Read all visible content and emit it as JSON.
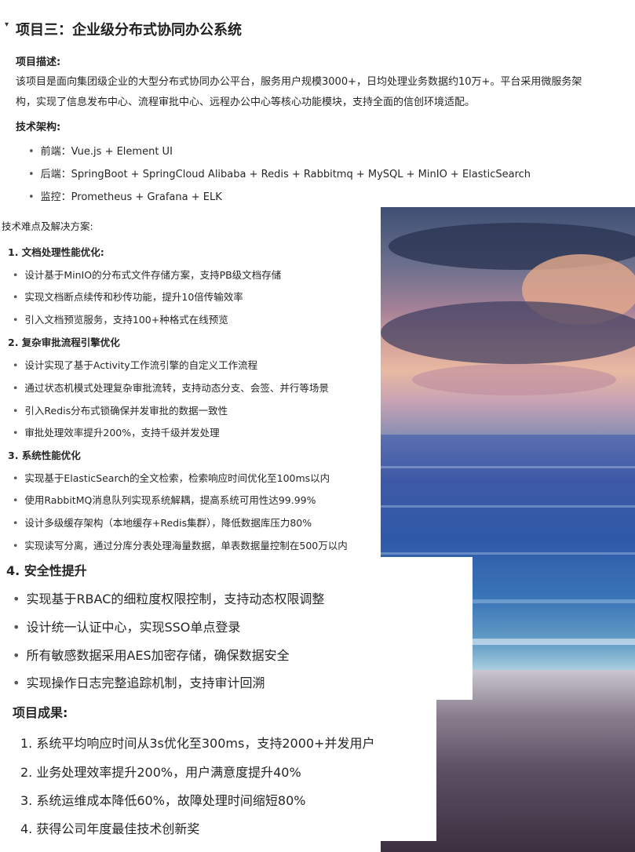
{
  "section1": {
    "title": "项目三：企业级分布式协同办公系统",
    "desc_label": "项目描述:",
    "desc_line1": "该项目是面向集团级企业的大型分布式协同办公平台，服务用户规模3000+，日均处理业务数据约10万+。平台采用微服务架",
    "desc_line2": "构，实现了信息发布中心、流程审批中心、远程办公中心等核心功能模块，支持全面的信创环境适配。",
    "arch_label": "技术架构:",
    "arch_items": [
      "前端：Vue.js + Element UI",
      "后端：SpringBoot + SpringCloud Alibaba + Redis + Rabbitmq + MySQL +  MinIO + ElasticSearch",
      "监控：Prometheus + Grafana + ELK"
    ]
  },
  "section2": {
    "label": "技术难点及解决方案:",
    "groups": [
      {
        "title": "1. 文档处理性能优化:",
        "items": [
          "设计基于MinIO的分布式文件存储方案，支持PB级文档存储",
          "实现文档断点续传和秒传功能，提升10倍传输效率",
          "引入文档预览服务，支持100+种格式在线预览"
        ]
      },
      {
        "title": "2. 复杂审批流程引擎优化",
        "items": [
          "设计实现了基于Activity工作流引擎的自定义工作流程",
          "通过状态机模式处理复杂审批流转，支持动态分支、会签、并行等场景",
          "引入Redis分布式锁确保并发审批的数据一致性",
          "审批处理效率提升200%，支持千级并发处理"
        ]
      },
      {
        "title": "3. 系统性能优化",
        "items": [
          "实现基于ElasticSearch的全文检索，检索响应时间优化至100ms以内",
          "使用RabbitMQ消息队列实现系统解耦，提高系统可用性达99.99%",
          "设计多级缓存架构（本地缓存+Redis集群），降低数据库压力80%",
          "实现读写分离，通过分库分表处理海量数据，单表数据量控制在500万以内"
        ]
      }
    ]
  },
  "section3": {
    "title": "4. 安全性提升",
    "items": [
      "实现基于RBAC的细粒度权限控制，支持动态权限调整",
      "设计统一认证中心，实现SSO单点登录",
      "所有敏感数据采用AES加密存储，确保数据安全",
      "实现操作日志完整追踪机制，支持审计回溯"
    ]
  },
  "section4": {
    "label": "项目成果:",
    "items": [
      "1. 系统平均响应时间从3s优化至300ms，支持2000+并发用户",
      "2. 业务处理效率提升200%，用户满意度提升40%",
      "3. 系统运维成本降低60%，故障处理时间缩短80%",
      "4. 获得公司年度最佳技术创新奖"
    ]
  }
}
